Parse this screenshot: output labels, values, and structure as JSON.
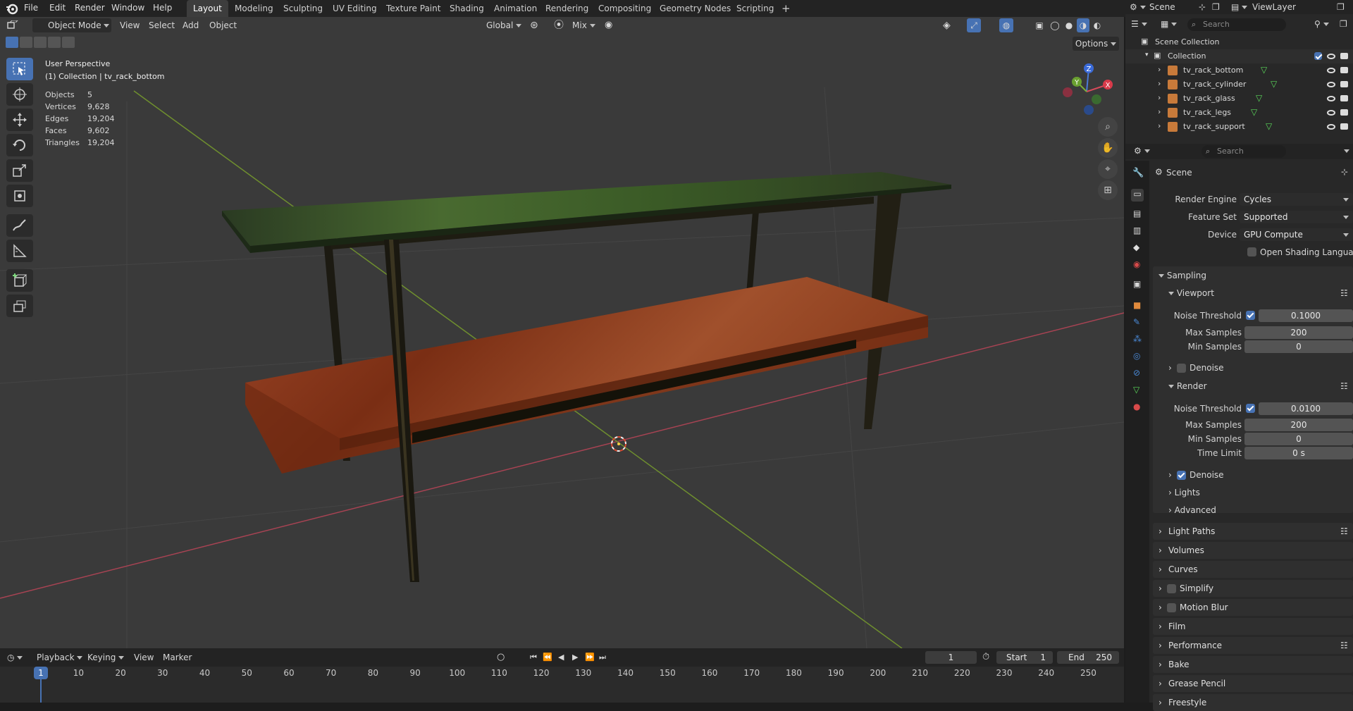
{
  "menu": [
    "File",
    "Edit",
    "Render",
    "Window",
    "Help"
  ],
  "workspaces": [
    "Layout",
    "Modeling",
    "Sculpting",
    "UV Editing",
    "Texture Paint",
    "Shading",
    "Animation",
    "Rendering",
    "Compositing",
    "Geometry Nodes",
    "Scripting"
  ],
  "active_workspace": "Layout",
  "scene_name": "Scene",
  "view_layer": "ViewLayer",
  "viewport": {
    "mode": "Object Mode",
    "menu": [
      "View",
      "Select",
      "Add",
      "Object"
    ],
    "orientation": "Global",
    "snap_mode": "Mix",
    "options": "Options",
    "overlay_title": "User Perspective",
    "overlay_subtitle": "(1) Collection | tv_rack_bottom",
    "stats": [
      {
        "label": "Objects",
        "value": "5"
      },
      {
        "label": "Vertices",
        "value": "9,628"
      },
      {
        "label": "Edges",
        "value": "19,204"
      },
      {
        "label": "Faces",
        "value": "9,602"
      },
      {
        "label": "Triangles",
        "value": "19,204"
      }
    ],
    "gizmo": {
      "x": "X",
      "y": "Y",
      "z": "Z"
    }
  },
  "outliner": {
    "search_placeholder": "Search",
    "root": "Scene Collection",
    "collection": "Collection",
    "objects": [
      "tv_rack_bottom",
      "tv_rack_cylinder",
      "tv_rack_glass",
      "tv_rack_legs",
      "tv_rack_support"
    ]
  },
  "properties": {
    "search_placeholder": "Search",
    "context": "Scene",
    "render_engine_label": "Render Engine",
    "render_engine": "Cycles",
    "feature_set_label": "Feature Set",
    "feature_set": "Supported",
    "device_label": "Device",
    "device": "GPU Compute",
    "osl_label": "Open Shading Language",
    "sampling": "Sampling",
    "viewport_label": "Viewport",
    "vp_noise_label": "Noise Threshold",
    "vp_noise": "0.1000",
    "vp_max_label": "Max Samples",
    "vp_max": "200",
    "vp_min_label": "Min Samples",
    "vp_min": "0",
    "vp_denoise_label": "Denoise",
    "render_label": "Render",
    "r_noise_label": "Noise Threshold",
    "r_noise": "0.0100",
    "r_max_label": "Max Samples",
    "r_max": "200",
    "r_min_label": "Min Samples",
    "r_min": "0",
    "r_time_label": "Time Limit",
    "r_time": "0 s",
    "r_denoise_label": "Denoise",
    "lights": "Lights",
    "advanced": "Advanced",
    "sections": [
      "Light Paths",
      "Volumes",
      "Curves",
      "Simplify",
      "Motion Blur",
      "Film",
      "Performance",
      "Bake",
      "Grease Pencil",
      "Freestyle"
    ]
  },
  "timeline": {
    "menu": [
      "Playback",
      "Keying",
      "View",
      "Marker"
    ],
    "current_frame": "1",
    "start_label": "Start",
    "start": "1",
    "end_label": "End",
    "end": "250",
    "ticks": [
      "10",
      "20",
      "30",
      "40",
      "50",
      "60",
      "70",
      "80",
      "90",
      "100",
      "110",
      "120",
      "130",
      "140",
      "150",
      "160",
      "170",
      "180",
      "190",
      "200",
      "210",
      "220",
      "230",
      "240",
      "250"
    ]
  },
  "colors": {
    "accent": "#4772b3",
    "header": "#232323",
    "viewport_bg": "#3a3a3a",
    "axis_x": "#b04050",
    "axis_y": "#6a8a30",
    "wood": "#8b3a1c",
    "glass": "#2e4a20",
    "mesh_icon": "#e08a3c"
  }
}
